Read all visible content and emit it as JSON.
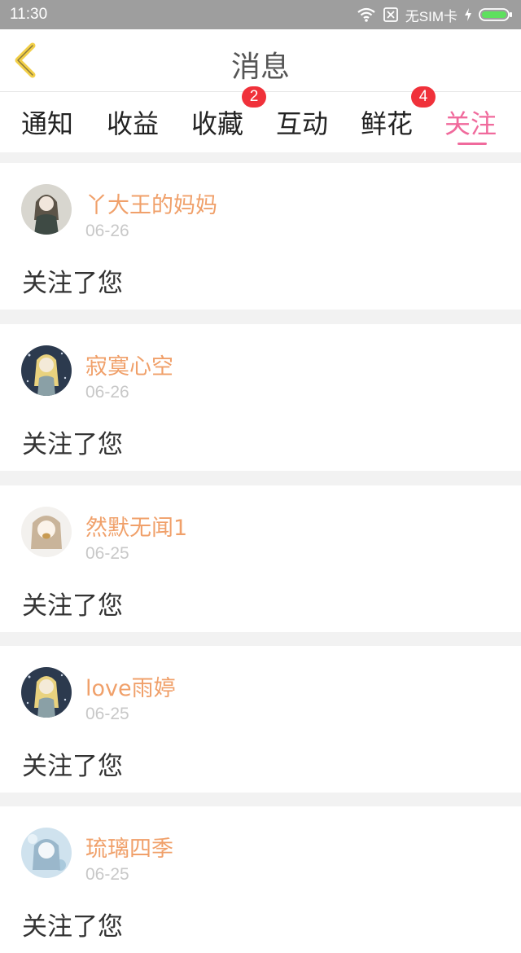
{
  "status_bar": {
    "time": "11:30",
    "carrier": "无SIM卡"
  },
  "header": {
    "title": "消息"
  },
  "tabs": [
    {
      "label": "通知",
      "badge": ""
    },
    {
      "label": "收益",
      "badge": ""
    },
    {
      "label": "收藏",
      "badge": "2"
    },
    {
      "label": "互动",
      "badge": ""
    },
    {
      "label": "鲜花",
      "badge": "4"
    },
    {
      "label": "关注",
      "badge": "",
      "active": true
    }
  ],
  "messages": [
    {
      "name": "丫大王的妈妈",
      "date": "06-26",
      "text": "关注了您",
      "avatar": "avatar-girl-dark-dress"
    },
    {
      "name": "寂寞心空",
      "date": "06-26",
      "text": "关注了您",
      "avatar": "avatar-anime-girl-night"
    },
    {
      "name": "然默无闻1",
      "date": "06-25",
      "text": "关注了您",
      "avatar": "avatar-anime-girl-light"
    },
    {
      "name": "love雨婷",
      "date": "06-25",
      "text": "关注了您",
      "avatar": "avatar-anime-girl-night"
    },
    {
      "name": "琉璃四季",
      "date": "06-25",
      "text": "关注了您",
      "avatar": "avatar-anime-girl-blue"
    }
  ],
  "colors": {
    "accent": "#f06a9c",
    "name": "#f0a06a",
    "badge": "#f0313a"
  }
}
